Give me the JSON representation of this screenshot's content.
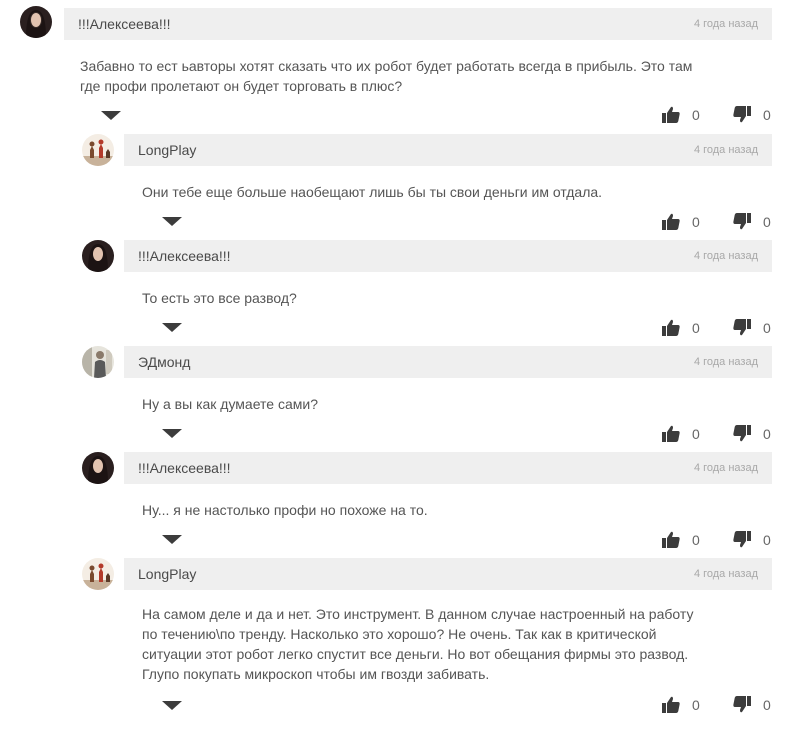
{
  "comments": [
    {
      "author": "!!!Алексеева!!!",
      "time": "4 года назад",
      "text": "Забавно то ест ьавторы хотят сказать что их робот будет работать всегда в прибыль. Это там\nгде профи пролетают он будет торговать в плюс?",
      "likes": "0",
      "dislikes": "0",
      "avatar_icon": "avatar-dark-hair-icon"
    },
    {
      "author": "LongPlay",
      "time": "4 года назад",
      "text": "Они тебе еще больше наобещают лишь бы ты свои деньги им отдала.",
      "likes": "0",
      "dislikes": "0",
      "avatar_icon": "avatar-chess-icon"
    },
    {
      "author": "!!!Алексеева!!!",
      "time": "4 года назад",
      "text": "То есть это все развод?",
      "likes": "0",
      "dislikes": "0",
      "avatar_icon": "avatar-dark-hair-icon"
    },
    {
      "author": "ЭДмонд",
      "time": "4 года назад",
      "text": "Ну а вы как думаете сами?",
      "likes": "0",
      "dislikes": "0",
      "avatar_icon": "avatar-figure-icon"
    },
    {
      "author": "!!!Алексеева!!!",
      "time": "4 года назад",
      "text": "Ну... я не настолько профи но похоже на то.",
      "likes": "0",
      "dislikes": "0",
      "avatar_icon": "avatar-dark-hair-icon"
    },
    {
      "author": "LongPlay",
      "time": "4 года назад",
      "text": "На самом деле и да и нет. Это инструмент. В данном случае настроенный на работу\nпо течению\\по тренду. Насколько это хорошо? Не очень. Так как в критической\nситуации этот робот легко спустит все деньги. Но вот обещания фирмы это развод.\nГлупо покупать микроскоп чтобы им гвозди забивать.",
      "likes": "0",
      "dislikes": "0",
      "avatar_icon": "avatar-chess-icon"
    }
  ],
  "colors": {
    "header_bg": "#efefef",
    "icon": "#3c3c3c",
    "time": "#a8a8a8"
  }
}
